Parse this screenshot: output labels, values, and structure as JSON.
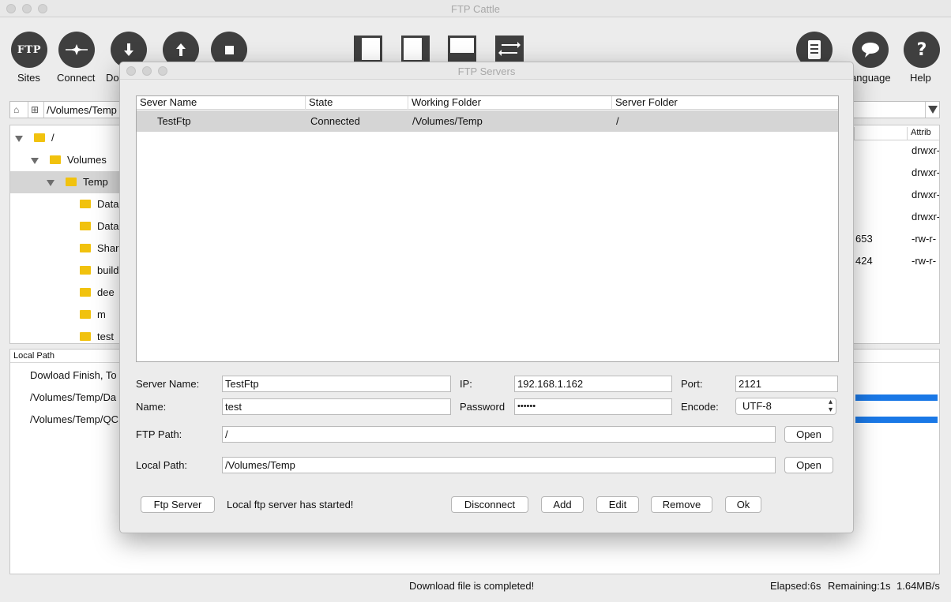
{
  "window": {
    "title": "FTP Cattle"
  },
  "toolbar": {
    "sites": "Sites",
    "connect": "Connect",
    "download_partial": "Do",
    "language_partial": "anguage",
    "help": "Help",
    "ftp_badge": "FTP"
  },
  "pathbar": {
    "local_path": "/Volumes/Temp"
  },
  "tree": {
    "items": [
      {
        "label": "/"
      },
      {
        "label": "Volumes"
      },
      {
        "label": "Temp"
      },
      {
        "label": "DataI"
      },
      {
        "label": "DataI"
      },
      {
        "label": "Share"
      },
      {
        "label": "build"
      },
      {
        "label": "dee"
      },
      {
        "label": "m"
      },
      {
        "label": "test"
      }
    ]
  },
  "remote": {
    "attrib_header": "Attrib",
    "rows": [
      {
        "size": "",
        "attrib": "drwxr-"
      },
      {
        "size": "",
        "attrib": "drwxr-"
      },
      {
        "size": "",
        "attrib": "drwxr-"
      },
      {
        "size": "",
        "attrib": "drwxr-"
      },
      {
        "size": "653",
        "attrib": "-rw-r-"
      },
      {
        "size": "424",
        "attrib": "-rw-r-"
      }
    ]
  },
  "log": {
    "header": "Local Path",
    "rows": [
      {
        "text": "Dowload Finish, To",
        "progress": null
      },
      {
        "text": "/Volumes/Temp/Da",
        "progress": 1.0
      },
      {
        "text": "/Volumes/Temp/QC",
        "progress": 1.0
      }
    ]
  },
  "status": {
    "message": "Download file is completed!",
    "elapsed": "Elapsed:6s",
    "remaining": "Remaining:1s",
    "speed": "1.64MB/s"
  },
  "dialog": {
    "title": "FTP Servers",
    "columns": [
      "Sever Name",
      "State",
      "Working Folder",
      "Server Folder"
    ],
    "rows": [
      {
        "name": "TestFtp",
        "state": "Connected",
        "working_folder": "/Volumes/Temp",
        "server_folder": "/"
      }
    ],
    "form": {
      "server_name_label": "Server Name:",
      "server_name": "TestFtp",
      "ip_label": "IP:",
      "ip": "192.168.1.162",
      "port_label": "Port:",
      "port": "2121",
      "name_label": "Name:",
      "name": "test",
      "password_label": "Password",
      "password_mask": "••••••",
      "encode_label": "Encode:",
      "encode": "UTF-8",
      "ftp_path_label": "FTP Path:",
      "ftp_path": "/",
      "local_path_label": "Local Path:",
      "local_path": "/Volumes/Temp",
      "open": "Open"
    },
    "buttons": {
      "ftp_server": "Ftp Server",
      "server_status": "Local ftp server has started!",
      "disconnect": "Disconnect",
      "add": "Add",
      "edit": "Edit",
      "remove": "Remove",
      "ok": "Ok"
    }
  }
}
